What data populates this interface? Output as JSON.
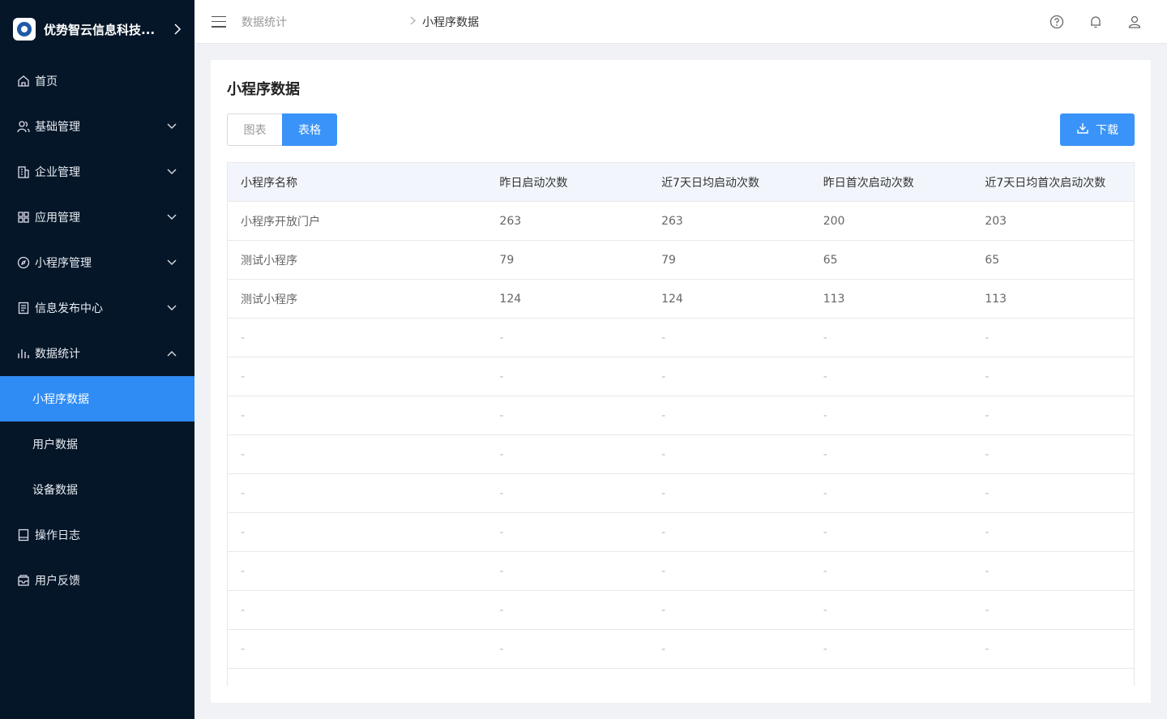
{
  "sidebar": {
    "brand": "优势智云信息科技...",
    "items": [
      {
        "label": "首页",
        "icon": "home-icon"
      },
      {
        "label": "基础管理",
        "icon": "users-icon"
      },
      {
        "label": "企业管理",
        "icon": "building-icon"
      },
      {
        "label": "应用管理",
        "icon": "grid-icon"
      },
      {
        "label": "小程序管理",
        "icon": "compass-icon"
      },
      {
        "label": "信息发布中心",
        "icon": "document-icon"
      },
      {
        "label": "数据统计",
        "icon": "bar-chart-icon"
      }
    ],
    "sub_items": [
      {
        "label": "小程序数据"
      },
      {
        "label": "用户数据"
      },
      {
        "label": "设备数据"
      }
    ],
    "bottom_items": [
      {
        "label": "操作日志",
        "icon": "book-icon"
      },
      {
        "label": "用户反馈",
        "icon": "feedback-icon"
      }
    ]
  },
  "header": {
    "breadcrumb": [
      "数据统计",
      "小程序数据"
    ]
  },
  "main": {
    "title": "小程序数据",
    "tabs": [
      {
        "label": "图表"
      },
      {
        "label": "表格"
      }
    ],
    "active_tab": "表格",
    "download_label": "下载",
    "table": {
      "columns": [
        "小程序名称",
        "昨日启动次数",
        "近7天日均启动次数",
        "昨日首次启动次数",
        "近7天日均首次启动次数"
      ],
      "rows": [
        [
          "小程序开放门户",
          "263",
          "263",
          "200",
          "203"
        ],
        [
          "测试小程序",
          "79",
          "79",
          "65",
          "65"
        ],
        [
          "测试小程序",
          "124",
          "124",
          "113",
          "113"
        ],
        [
          "-",
          "-",
          "-",
          "-",
          "-"
        ],
        [
          "-",
          "-",
          "-",
          "-",
          "-"
        ],
        [
          "-",
          "-",
          "-",
          "-",
          "-"
        ],
        [
          "-",
          "-",
          "-",
          "-",
          "-"
        ],
        [
          "-",
          "-",
          "-",
          "-",
          "-"
        ],
        [
          "-",
          "-",
          "-",
          "-",
          "-"
        ],
        [
          "-",
          "-",
          "-",
          "-",
          "-"
        ],
        [
          "-",
          "-",
          "-",
          "-",
          "-"
        ],
        [
          "-",
          "-",
          "-",
          "-",
          "-"
        ]
      ]
    }
  },
  "colors": {
    "sidebar_bg": "#051628",
    "accent": "#2f8cf5",
    "button": "#3a93f8"
  }
}
